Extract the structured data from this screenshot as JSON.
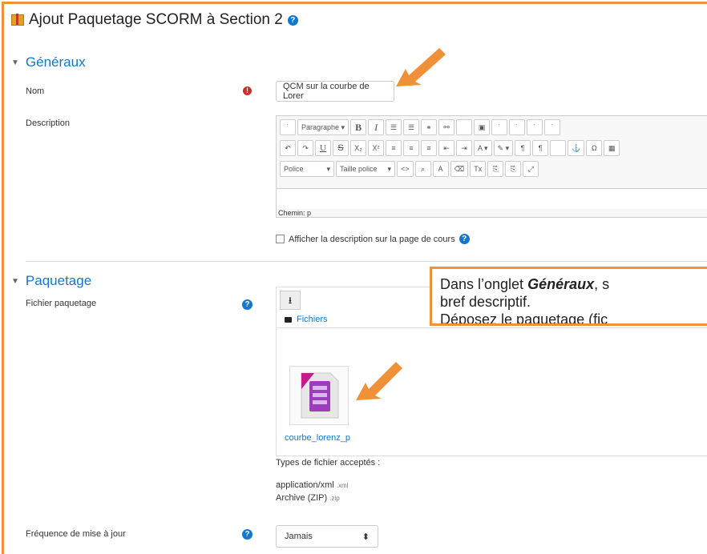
{
  "page": {
    "title": "Ajout Paquetage SCORM à Section 2"
  },
  "sections": {
    "generaux": "Généraux",
    "paquetage": "Paquetage"
  },
  "form": {
    "nom_label": "Nom",
    "nom_value": "QCM sur la courbe de Lorer",
    "description_label": "Description",
    "editor": {
      "paragraph_label": "Paragraphe",
      "font_label": "Police",
      "font_size_label": "Taille police",
      "path_label": "Chemin: p"
    },
    "show_description_label": "Afficher la description sur la page de cours",
    "fichier_label": "Fichier paquetage",
    "folder_label": "Fichiers",
    "file_name": "courbe_lorenz_p",
    "accepted_types_label": "Types de fichier acceptés :",
    "type1": "application/xml",
    "type1_ext": ".xml",
    "type2": "Archive (ZIP)",
    "type2_ext": ".zip",
    "frequence_label": "Fréquence de mise à jour",
    "frequence_value": "Jamais"
  },
  "callout": {
    "line1_prefix": "Dans l’onglet ",
    "line1_em": "Généraux",
    "line1_suffix": ", s",
    "line2": "bref descriptif.",
    "line3": "Déposez le paquetage (fic"
  },
  "colors": {
    "accent": "#f0913a",
    "link": "#1177d1",
    "required": "#c9302c"
  }
}
